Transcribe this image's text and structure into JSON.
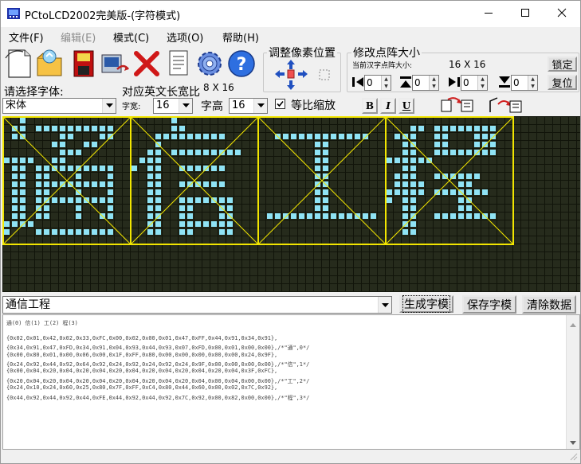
{
  "window": {
    "title": "PCtoLCD2002完美版-(字符模式)"
  },
  "menu": [
    {
      "label": "文件(F)",
      "enabled": true
    },
    {
      "label": "编辑(E)",
      "enabled": false
    },
    {
      "label": "模式(C)",
      "enabled": true
    },
    {
      "label": "选项(O)",
      "enabled": true
    },
    {
      "label": "帮助(H)",
      "enabled": true
    }
  ],
  "toolbar": {
    "icons": [
      "new-file-icon",
      "open-folder-icon",
      "save-disk-icon",
      "save-as-icon",
      "delete-x-icon",
      "document-notes-icon",
      "settings-gear-icon",
      "help-question-icon"
    ]
  },
  "pixel_adjust": {
    "title": "调整像素位置"
  },
  "dot_size": {
    "title": "修改点阵大小",
    "current_label": "当前汉字点阵大小:",
    "current_value": "16 X 16",
    "lock_label": "锁定",
    "reset_label": "复位",
    "spinners": [
      "0",
      "0",
      "0",
      "0"
    ]
  },
  "font": {
    "choose_label": "请选择字体:",
    "eng_ratio_label": "对应英文长宽比",
    "eng_ratio_value": "8 X 16",
    "font_name": "宋体",
    "width_label": "字宽:",
    "width_value": "16",
    "height_label": "字高",
    "height_value": "16",
    "proportional_label": "等比缩放",
    "proportional_checked": true,
    "bold_label": "B",
    "italic_label": "I",
    "underline_label": "U"
  },
  "matrix": {
    "text": "通信工程",
    "bg_color": "#262b1c",
    "on_color": "#8fe3f5",
    "grid_color": "#11140a",
    "frame_color": "#f2e600",
    "glyphs": [
      [
        "0010000000000000",
        "0110111111111100",
        "0110000110001100",
        "0000001100110000",
        "0000000111000000",
        "1111001100000000",
        "0110111111111100",
        "0110110001000100",
        "0110111111111100",
        "0110110001000100",
        "0110111111111100",
        "0110110001000100",
        "0110110001001100",
        "1111000000000000",
        "1000111111111100",
        "0000000000000000"
      ],
      [
        "0000010000000000",
        "0000011000000000",
        "0001111111110000",
        "0001000000000000",
        "0011011111111100",
        "0111000000000000",
        "1011001111110000",
        "0011000000000000",
        "0011001111110000",
        "0011000000000000",
        "0011001111111000",
        "0011001100011000",
        "0011001100011000",
        "0011001111111000",
        "0011001100011000",
        "0000000000000000"
      ],
      [
        "0000000000000000",
        "0000000000000000",
        "0011111111111100",
        "0000000110000000",
        "0000000110000000",
        "0000000110000000",
        "0000000110000000",
        "0000000110000000",
        "0000000110000000",
        "0000000110000000",
        "0000000110000000",
        "0000000110000000",
        "0111111111111110",
        "0000000000000000",
        "0000000000000000",
        "0000000000000000"
      ],
      [
        "0000000000000000",
        "0001101111111100",
        "0111001100011100",
        "0011001100011100",
        "0011001111111100",
        "1111110000000000",
        "0011000000000000",
        "0111001111110000",
        "0111100001100000",
        "1111101111111000",
        "1011000001100000",
        "0011000001100000",
        "0011001111111100",
        "0011000000000000",
        "0011000000000000",
        "0000000000000000"
      ]
    ]
  },
  "text_input": {
    "value": "通信工程"
  },
  "buttons": {
    "generate": "生成字模",
    "save": "保存字模",
    "clear": "清除数据"
  },
  "output": {
    "lines": [
      "通(0) 信(1) 工(2) 程(3)",
      "",
      "{0x02,0x01,0x42,0x02,0x33,0xFC,0x00,0x02,0x00,0x01,0x47,0xFF,0x44,0x91,0x34,0x91},",
      "{0x34,0x91,0x47,0xFD,0x34,0x91,0x04,0x93,0x44,0x93,0x07,0xFD,0x00,0x01,0x00,0x00},/*\"通\",0*/",
      "{0x00,0x80,0x01,0x00,0x06,0x00,0x1F,0xFF,0x80,0x00,0x00,0x00,0x00,0x00,0x24,0x9F},",
      "{0x24,0x92,0x44,0x92,0x64,0x92,0x24,0x92,0x24,0x92,0x24,0x9F,0x00,0x00,0x00,0x00},/*\"信\",1*/",
      "{0x00,0x04,0x20,0x04,0x20,0x04,0x20,0x04,0x20,0x04,0x20,0x04,0x20,0x04,0x3F,0xFC},",
      "{0x20,0x04,0x20,0x04,0x20,0x04,0x20,0x04,0x20,0x04,0x20,0x04,0x00,0x04,0x00,0x00},/*\"工\",2*/",
      "{0x24,0x10,0x24,0x60,0x25,0x80,0x7F,0xFF,0xC4,0x80,0x44,0x60,0x00,0x02,0x7C,0x92},",
      "{0x44,0x92,0x44,0x92,0x44,0xFE,0x44,0x92,0x44,0x92,0x7C,0x92,0x00,0x82,0x00,0x00},/*\"程\",3*/"
    ]
  }
}
